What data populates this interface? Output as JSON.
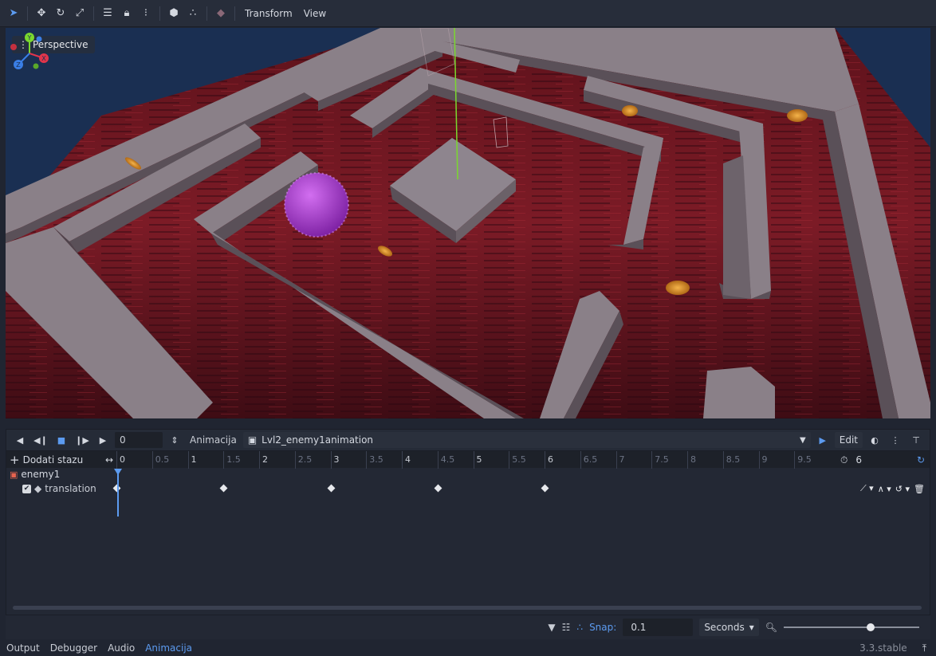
{
  "toolbar": {
    "icons": [
      "select-icon",
      "move-icon",
      "rotate-icon",
      "scale-icon",
      "list-select-icon",
      "lock-icon",
      "group-icon",
      "local-space-icon",
      "snap-icon",
      "light-icon"
    ],
    "menus": [
      "Transform",
      "View"
    ]
  },
  "viewport": {
    "perspective_label": "Perspective",
    "gizmo_axes": [
      "X",
      "Y",
      "Z"
    ]
  },
  "animation": {
    "time_value": "0",
    "animation_label": "Animacija",
    "animation_name": "Lvl2_enemy1animation",
    "edit_label": "Edit",
    "add_track_label": "Dodati stazu",
    "ruler_ticks": [
      "0",
      "0.5",
      "1",
      "1.5",
      "2",
      "2.5",
      "3",
      "3.5",
      "4",
      "4.5",
      "5",
      "5.5",
      "6",
      "6.5",
      "7",
      "7.5",
      "8",
      "8.5",
      "9",
      "9.5"
    ],
    "length_value": "6",
    "tracks": [
      {
        "node": "enemy1",
        "property": "translation",
        "keyframe_times": [
          0,
          1.5,
          3,
          4.5,
          6
        ]
      }
    ]
  },
  "snap": {
    "label": "Snap:",
    "value": "0.1",
    "unit": "Seconds",
    "zoom_level": 0.65
  },
  "statusbar": {
    "tabs": [
      "Output",
      "Debugger",
      "Audio",
      "Animacija"
    ],
    "active_tab": "Animacija",
    "version": "3.3.stable"
  },
  "colors": {
    "accent": "#5c9bf0",
    "background": "#202531",
    "floor": "#7a1a24",
    "wall": "#8a8088",
    "enemy": "#a63bc9",
    "coin": "#d88a1c"
  }
}
